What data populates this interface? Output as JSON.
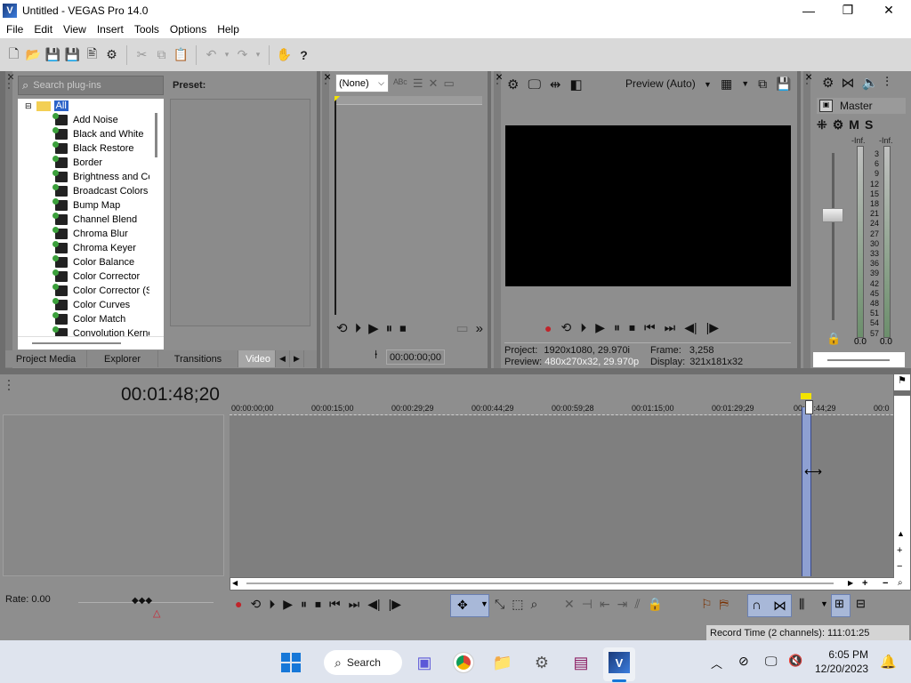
{
  "window": {
    "title": "Untitled - VEGAS Pro 14.0",
    "minimize": "—",
    "maximize": "❐",
    "close": "✕"
  },
  "menu": [
    "File",
    "Edit",
    "View",
    "Insert",
    "Tools",
    "Options",
    "Help"
  ],
  "explorer": {
    "search_placeholder": "Search plug-ins",
    "preset_label": "Preset:",
    "tree_root": "All",
    "plugins": [
      "Add Noise",
      "Black and White",
      "Black Restore",
      "Border",
      "Brightness and Co",
      "Broadcast Colors",
      "Bump Map",
      "Channel Blend",
      "Chroma Blur",
      "Chroma Keyer",
      "Color Balance",
      "Color Corrector",
      "Color Corrector (S",
      "Color Curves",
      "Color Match",
      "Convolution Kerne"
    ],
    "tabs": [
      "Project Media",
      "Explorer",
      "Transitions",
      "Video"
    ]
  },
  "trimmer": {
    "dropdown": "(None)",
    "timecode": "00:00:00;00"
  },
  "preview": {
    "mode": "Preview (Auto)",
    "project_label": "Project:",
    "project_value": "1920x1080, 29.970i",
    "frame_label": "Frame:",
    "frame_value": "3,258",
    "preview_label": "Preview:",
    "preview_value": "480x270x32, 29.970p",
    "display_label": "Display:",
    "display_value": "321x181x32"
  },
  "mixer": {
    "master": "Master",
    "mute": "M",
    "solo": "S",
    "inf_left": "-Inf.",
    "inf_right": "-Inf.",
    "scale": [
      "3",
      "6",
      "9",
      "12",
      "15",
      "18",
      "21",
      "24",
      "27",
      "30",
      "33",
      "36",
      "39",
      "42",
      "45",
      "48",
      "51",
      "54",
      "57"
    ],
    "bottom_left": "0.0",
    "bottom_right": "0.0"
  },
  "timeline": {
    "time": "00:01:48;20",
    "rate": "Rate: 0.00",
    "ruler": [
      "00:00:00;00",
      "00:00:15;00",
      "00:00:29;29",
      "00:00:44;29",
      "00:00:59;28",
      "00:01:15;00",
      "00:01:29;29",
      "00:01:44;29",
      "00:0"
    ]
  },
  "status": {
    "record_time": "Record Time (2 channels): 111:01:25"
  },
  "taskbar": {
    "search": "Search",
    "time": "6:05 PM",
    "date": "12/20/2023"
  }
}
